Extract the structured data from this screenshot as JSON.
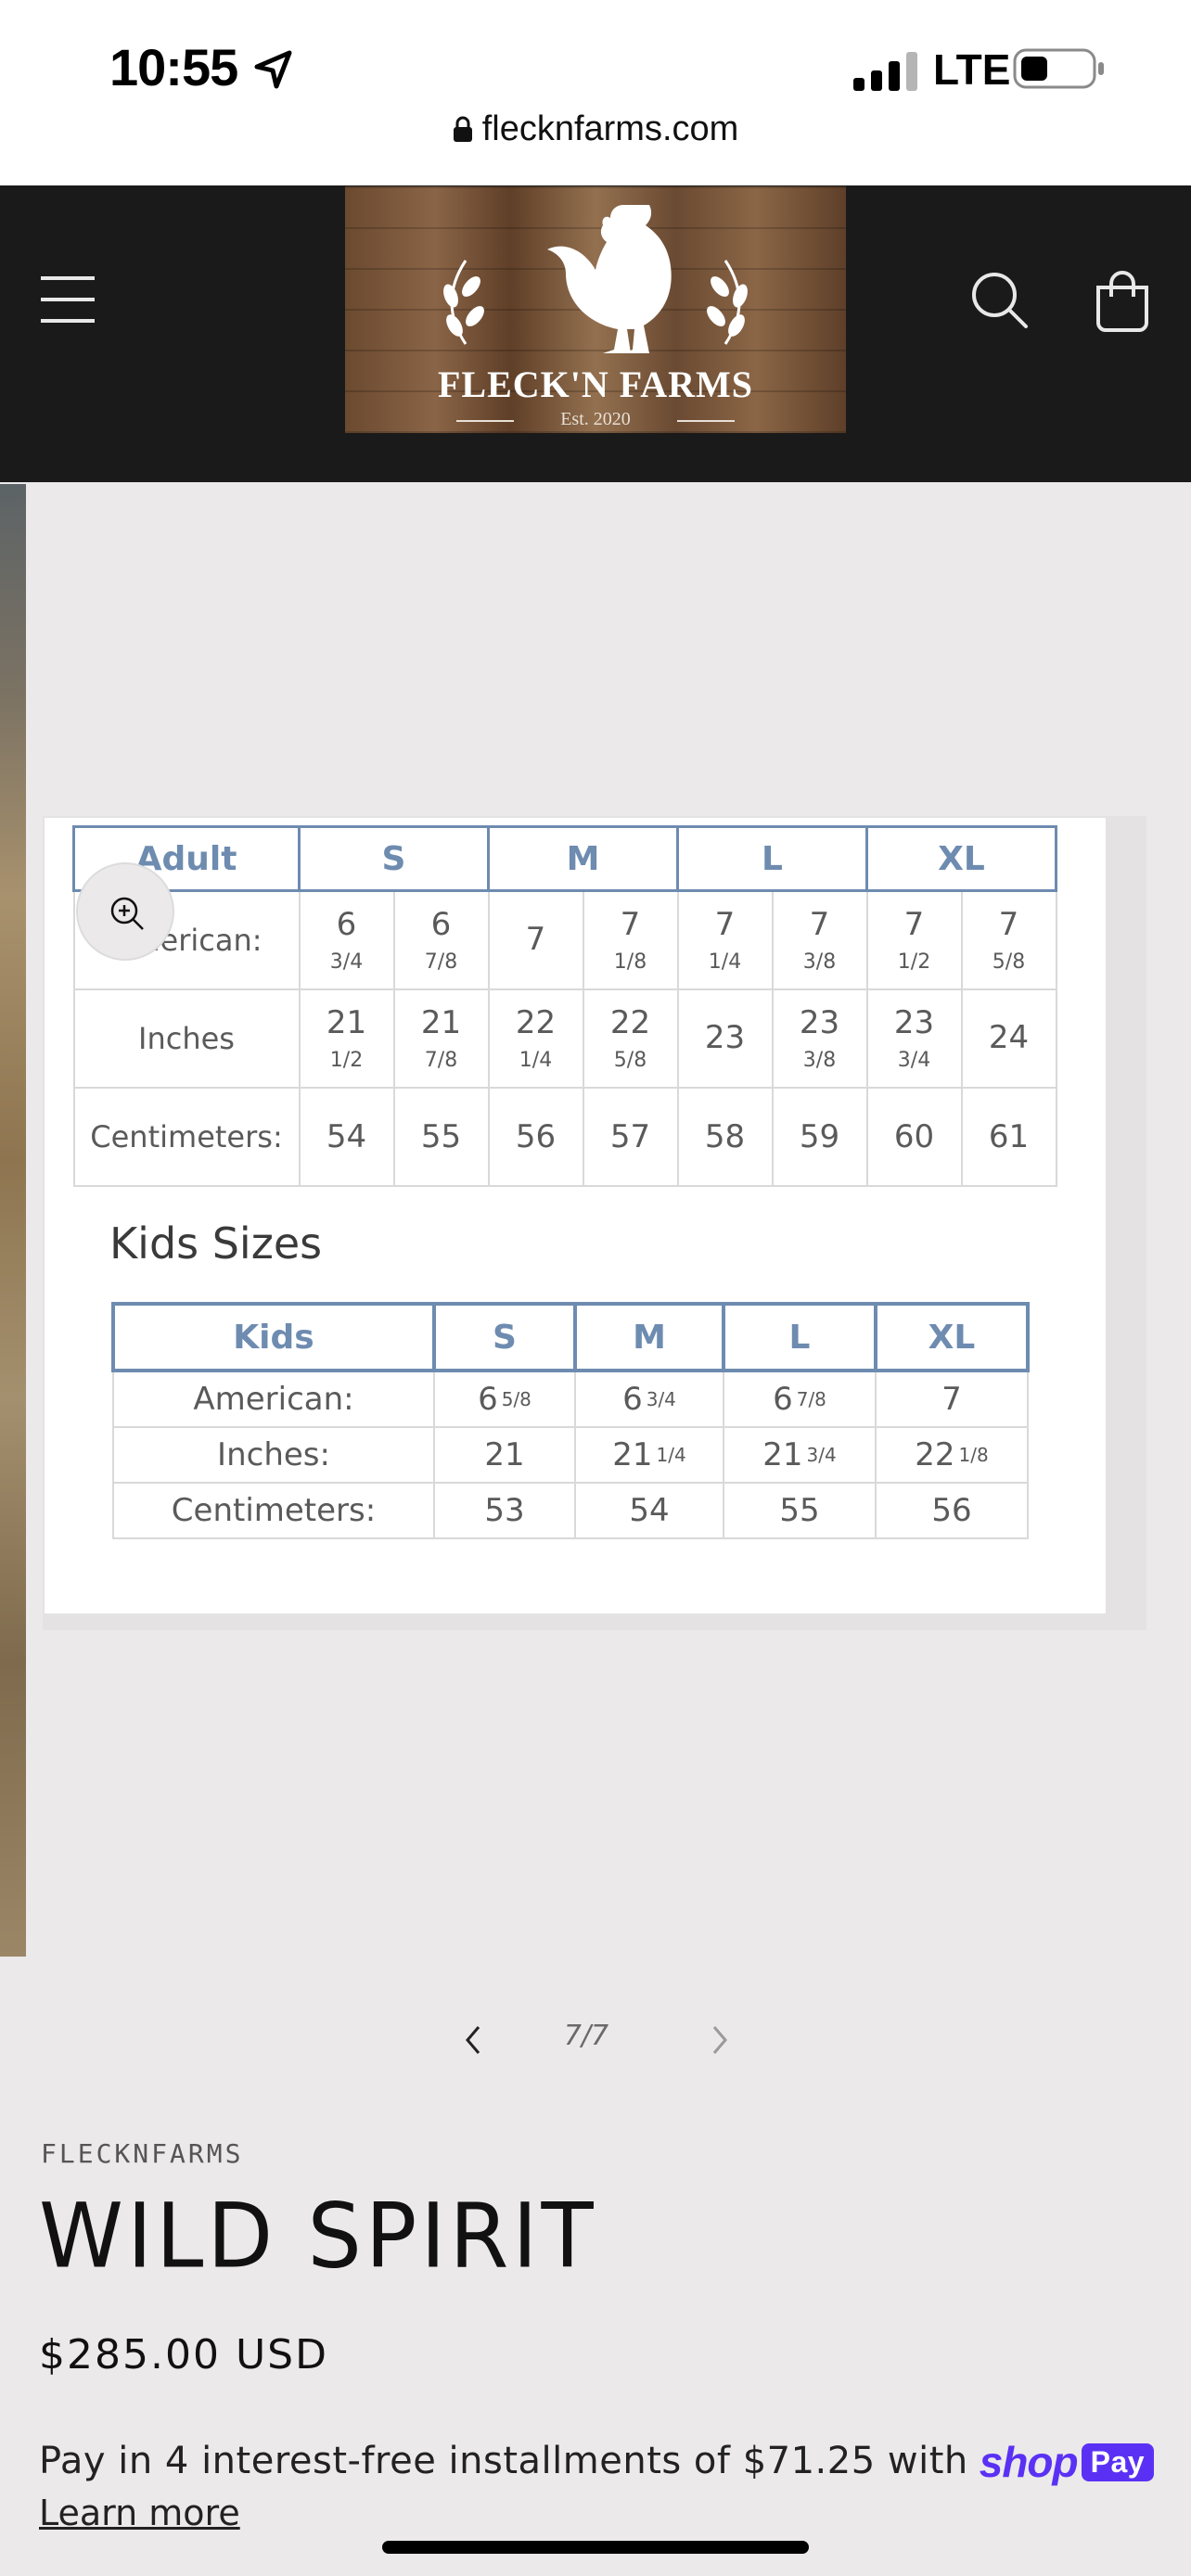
{
  "status_bar": {
    "time": "10:55",
    "network": "LTE",
    "url": "flecknfarms.com"
  },
  "header": {
    "logo_text": "FLECK'N FARMS",
    "logo_est": "Est. 2020"
  },
  "icons": {
    "menu": "hamburger-menu-icon",
    "search": "search-icon",
    "cart": "cart-icon",
    "zoom": "zoom-in-icon",
    "prev": "chevron-left-icon",
    "next": "chevron-right-icon"
  },
  "size_chart": {
    "adult": {
      "header": [
        "Adult",
        "S",
        "M",
        "L",
        "XL"
      ],
      "rows": [
        {
          "label": "American:",
          "cells": [
            [
              "6",
              "3/4"
            ],
            [
              "6",
              "7/8"
            ],
            [
              "7",
              ""
            ],
            [
              "7",
              "1/8"
            ],
            [
              "7",
              "1/4"
            ],
            [
              "7",
              "3/8"
            ],
            [
              "7",
              "1/2"
            ],
            [
              "7",
              "5/8"
            ]
          ]
        },
        {
          "label": "Inches",
          "cells": [
            [
              "21",
              "1/2"
            ],
            [
              "21",
              "7/8"
            ],
            [
              "22",
              "1/4"
            ],
            [
              "22",
              "5/8"
            ],
            [
              "23",
              ""
            ],
            [
              "23",
              "3/8"
            ],
            [
              "23",
              "3/4"
            ],
            [
              "24",
              ""
            ]
          ]
        },
        {
          "label": "Centimeters:",
          "cells": [
            [
              "54",
              ""
            ],
            [
              "55",
              ""
            ],
            [
              "56",
              ""
            ],
            [
              "57",
              ""
            ],
            [
              "58",
              ""
            ],
            [
              "59",
              ""
            ],
            [
              "60",
              ""
            ],
            [
              "61",
              ""
            ]
          ]
        }
      ]
    },
    "kids_title": "Kids Sizes",
    "kids": {
      "header": [
        "Kids",
        "S",
        "M",
        "L",
        "XL"
      ],
      "rows": [
        {
          "label": "American:",
          "cells": [
            [
              "6",
              "5/8"
            ],
            [
              "6",
              "3/4"
            ],
            [
              "6",
              "7/8"
            ],
            [
              "7",
              ""
            ]
          ]
        },
        {
          "label": "Inches:",
          "cells": [
            [
              "21",
              ""
            ],
            [
              "21",
              "1/4"
            ],
            [
              "21",
              "3/4"
            ],
            [
              "22",
              "1/8"
            ]
          ]
        },
        {
          "label": "Centimeters:",
          "cells": [
            [
              "53",
              ""
            ],
            [
              "54",
              ""
            ],
            [
              "55",
              ""
            ],
            [
              "56",
              ""
            ]
          ]
        }
      ]
    }
  },
  "pager": {
    "count": "7/7"
  },
  "product": {
    "vendor": "FLECKNFARMS",
    "title": "WILD SPIRIT",
    "price": "$285.00 USD",
    "installments": "Pay in 4 interest-free installments of $71.25 with",
    "shop_pay_shop": "shop",
    "shop_pay_pay": "Pay",
    "learn_more": "Learn more"
  },
  "colors": {
    "header_bg": "#1a1a1a",
    "page_bg": "#ebe9ea",
    "table_header": "#6e8bb0",
    "shop_pay": "#5a31f4"
  }
}
